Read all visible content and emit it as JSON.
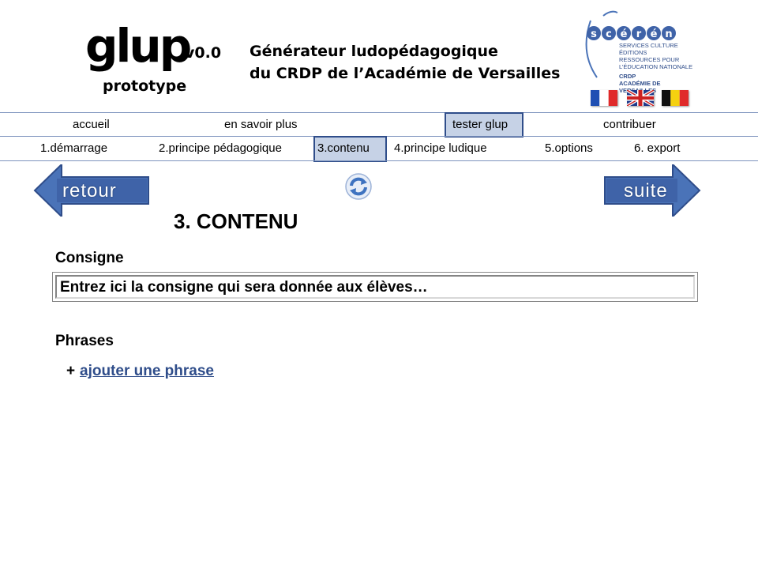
{
  "header": {
    "logo": "glup",
    "version": "v0.0",
    "subtitle": "prototype",
    "heading_line1": "Générateur ludopédagogique",
    "heading_line2": "du CRDP de l’Académie de Versailles",
    "sceren": {
      "brand": "scérén",
      "lines": [
        "SERVICES CULTURE ÉDITIONS",
        "RESSOURCES POUR",
        "L’ÉDUCATION NATIONALE",
        "CRDP",
        "ACADÉMIE DE VERSAILLES"
      ]
    },
    "flags": [
      "france-flag",
      "uk-flag",
      "belgium-flag"
    ]
  },
  "topnav": {
    "items": [
      "accueil",
      "en savoir plus",
      "tester glup",
      "contribuer"
    ],
    "active": "tester glup"
  },
  "steps": {
    "items": [
      "1.démarrage",
      "2.principe pédagogique",
      "3.contenu",
      "4.principe ludique",
      "5.options",
      "6. export"
    ],
    "active": "3.contenu"
  },
  "controls": {
    "back": "retour",
    "next": "suite",
    "refresh_icon": "refresh-icon"
  },
  "main": {
    "title": "3. CONTENU",
    "consigne_label": "Consigne",
    "consigne_placeholder": "Entrez ici la consigne qui sera donnée aux élèves…",
    "phrases_label": "Phrases",
    "add_plus": "+",
    "add_link": "ajouter une phrase"
  },
  "colors": {
    "accent": "#2f4d8a",
    "arrow": "#4a73b8",
    "active_bg": "#c6d2e6"
  }
}
